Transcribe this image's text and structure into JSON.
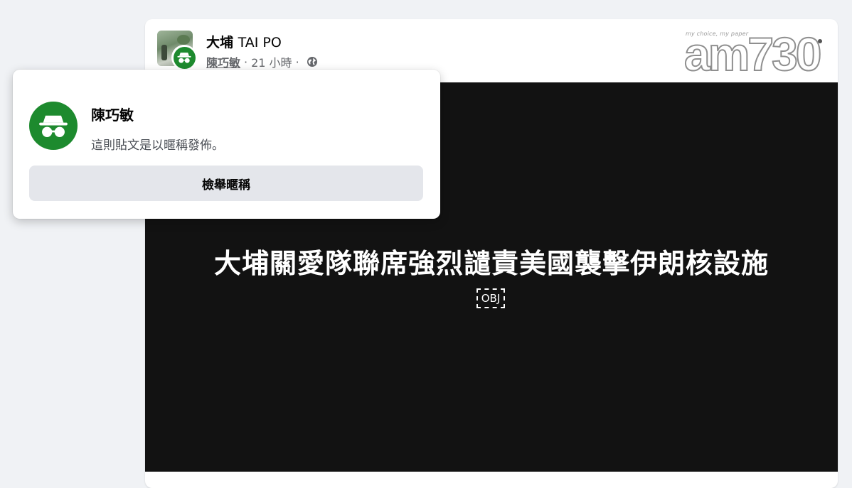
{
  "colors": {
    "page_bg": "#f0f2f5",
    "anonymous_green": "#1d8a2e",
    "media_bg": "#121212",
    "button_bg": "#e4e6eb",
    "meta_text": "#65676b"
  },
  "post": {
    "group_name_zh": "大埔",
    "group_name_en": "TAI PO",
    "author": "陳巧敏",
    "sep1": "·",
    "time": "21 小時",
    "sep2": "·",
    "audience_icon": "globe-icon",
    "more_icon": "more-options-icon"
  },
  "media": {
    "headline": "大埔關愛隊聯席強烈譴責美國襲擊伊朗核設施",
    "placeholder": "OBJ"
  },
  "brand": {
    "tagline": "my choice, my paper",
    "mark": "am730"
  },
  "popover": {
    "name": "陳巧敏",
    "description": "這則貼文是以暱稱發佈。",
    "report_button": "檢舉暱稱",
    "avatar_icon": "anonymous-incognito-icon"
  }
}
